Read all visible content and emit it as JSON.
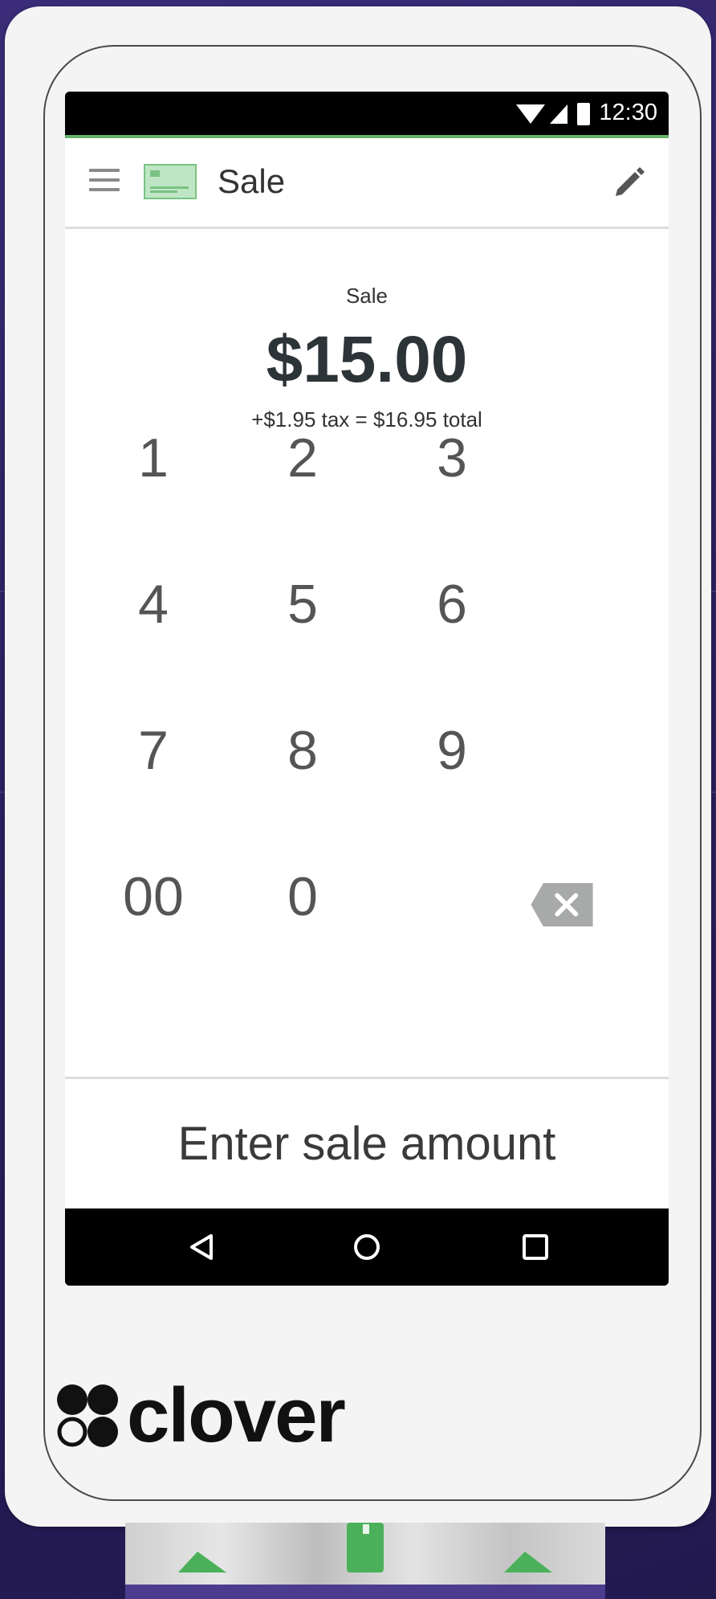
{
  "status_bar": {
    "time": "12:30"
  },
  "toolbar": {
    "title": "Sale"
  },
  "sale": {
    "label": "Sale",
    "amount": "$15.00",
    "tax_line": "+$1.95 tax = $16.95 total"
  },
  "keypad": {
    "keys": [
      "1",
      "2",
      "3",
      "4",
      "5",
      "6",
      "7",
      "8",
      "9",
      "00",
      "0"
    ]
  },
  "prompt": "Enter sale amount",
  "brand": {
    "name": "clover"
  },
  "colors": {
    "accent_green": "#64b46a",
    "background": "#2a1f5e",
    "text_dark": "#2c3438"
  }
}
